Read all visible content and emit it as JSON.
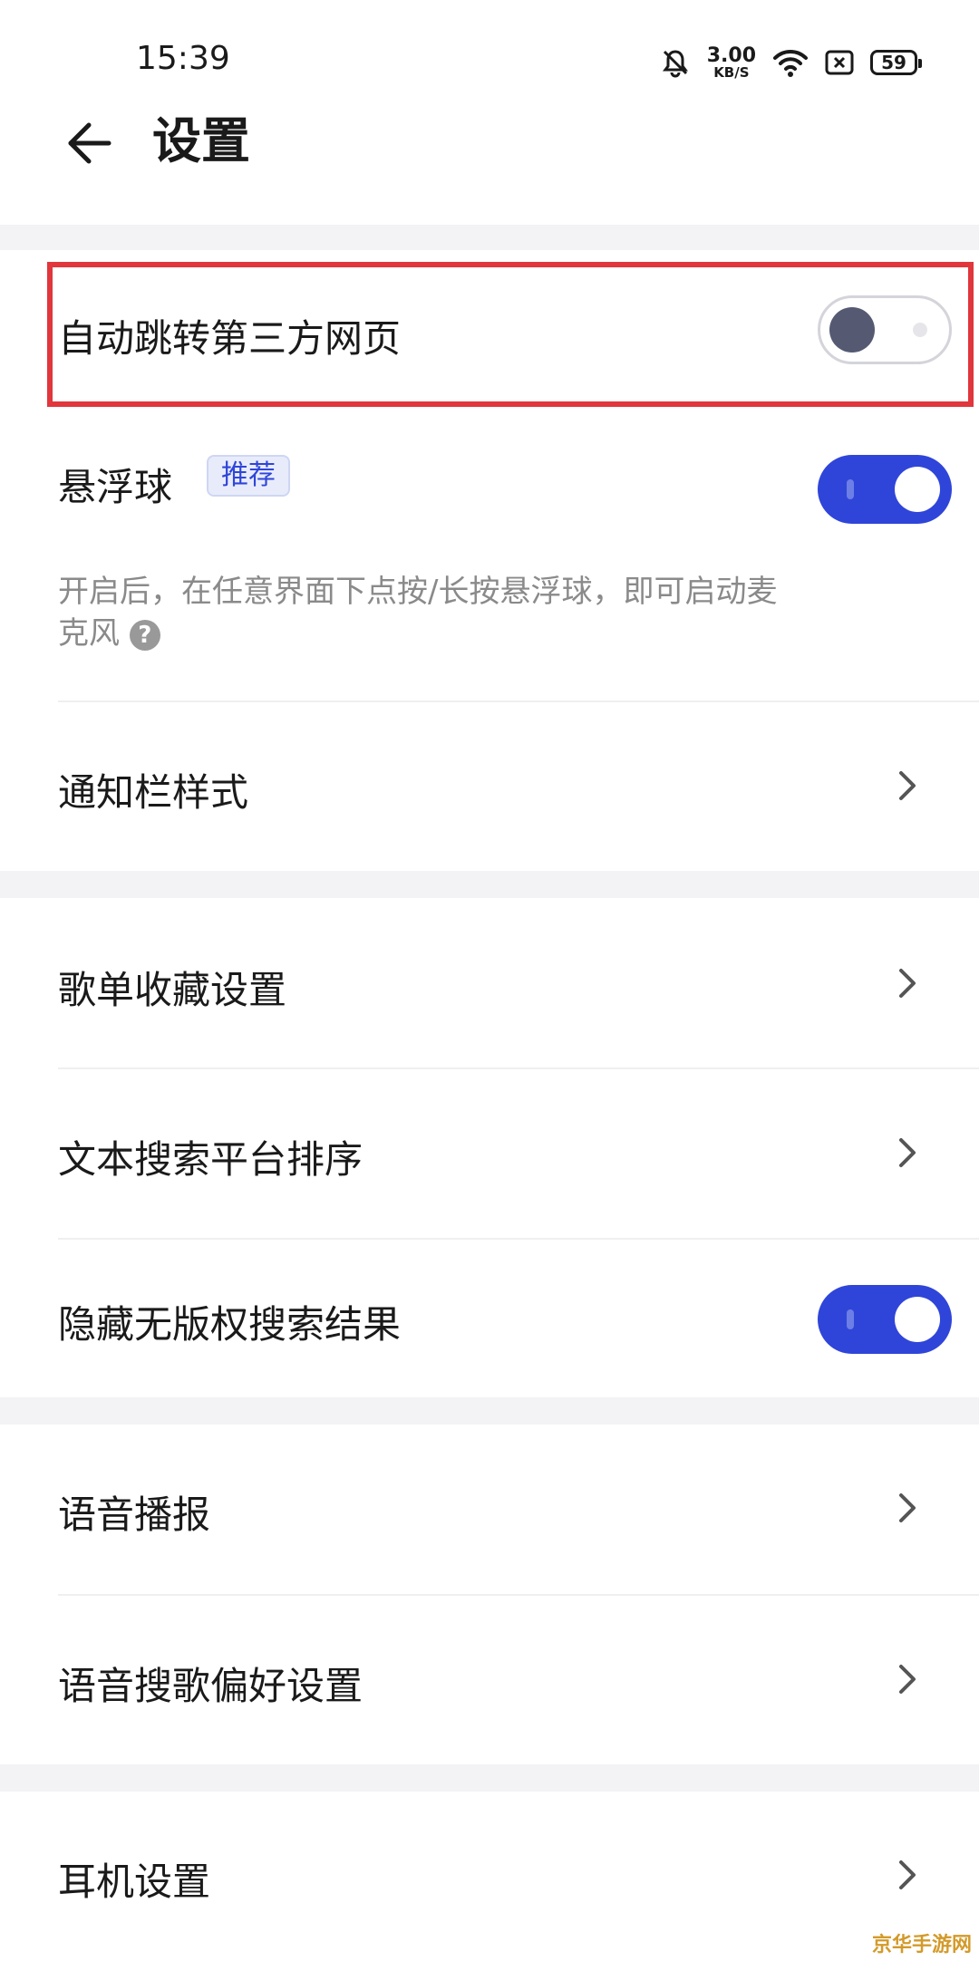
{
  "status_bar": {
    "time": "15:39",
    "net_speed_value": "3.00",
    "net_speed_unit": "KB/S",
    "battery_level": "59"
  },
  "header": {
    "title": "设置"
  },
  "settings": {
    "auto_jump": {
      "label": "自动跳转第三方网页",
      "enabled": false
    },
    "floating_ball": {
      "label": "悬浮球",
      "badge": "推荐",
      "enabled": true,
      "description": "开启后，在任意界面下点按/长按悬浮球，即可启动麦克风"
    },
    "notification_style": {
      "label": "通知栏样式"
    },
    "playlist_collect": {
      "label": "歌单收藏设置"
    },
    "text_search_sort": {
      "label": "文本搜索平台排序"
    },
    "hide_unlicensed": {
      "label": "隐藏无版权搜索结果",
      "enabled": true
    },
    "voice_broadcast": {
      "label": "语音播报"
    },
    "voice_search_pref": {
      "label": "语音搜歌偏好设置"
    },
    "headset_settings": {
      "label": "耳机设置"
    }
  },
  "watermark": "京华手游网",
  "colors": {
    "accent": "#2f45d9",
    "highlight_border": "#e0363c",
    "section_gap": "#f3f3f5"
  }
}
